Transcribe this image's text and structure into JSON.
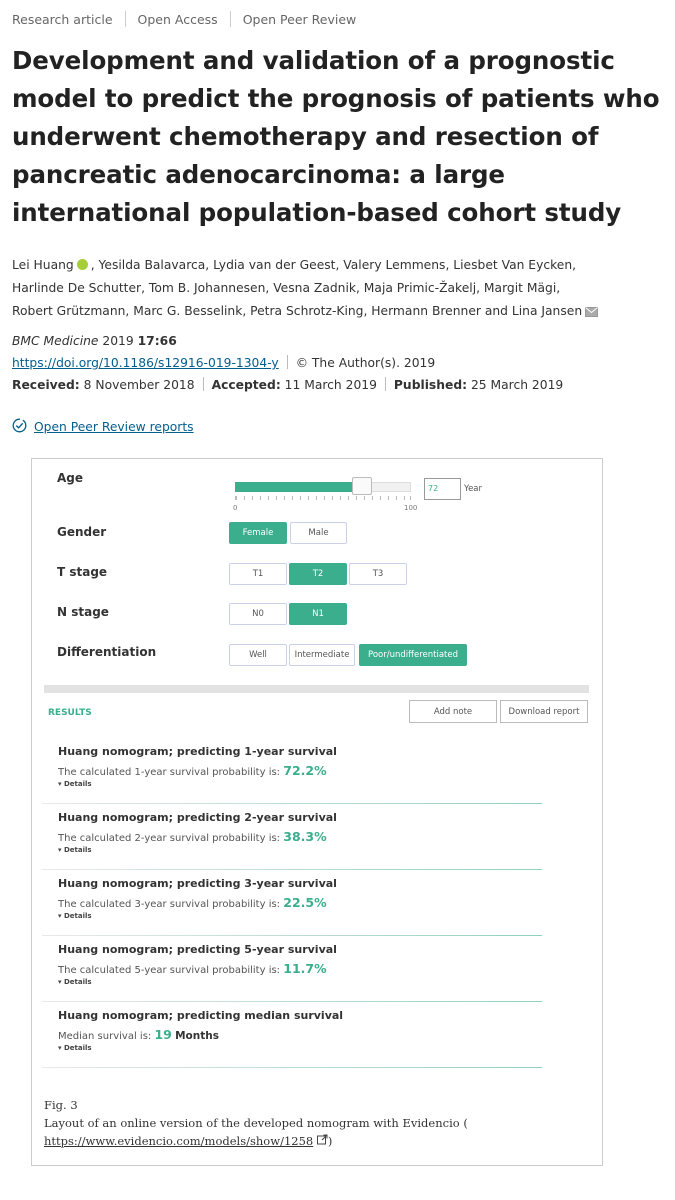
{
  "meta": {
    "type": "Research article",
    "access": "Open Access",
    "review": "Open Peer Review"
  },
  "article": {
    "title": "Development and validation of a prognostic model to predict the prognosis of patients who underwent chemotherapy and resection of pancreatic adenocarcinoma: a large international population-based cohort study"
  },
  "authors": {
    "line1_first": "Lei Huang",
    "line1_rest": ", Yesilda Balavarca, Lydia van der Geest, Valery Lemmens, Liesbet Van Eycken,",
    "line2": "Harlinde De Schutter, Tom B. Johannesen, Vesna Zadnik, Maja Primic-Žakelj, Margit Mägi,",
    "line3": "Robert Grützmann, Marc G. Besselink, Petra Schrotz-King, Hermann Brenner and Lina Jansen"
  },
  "citation": {
    "journal": "BMC Medicine",
    "year": "2019",
    "volume": "17:66",
    "doi": "https://doi.org/10.1186/s12916-019-1304-y",
    "copyright": "© The Author(s). 2019",
    "received_label": "Received:",
    "received": "8 November 2018",
    "accepted_label": "Accepted:",
    "accepted": "11 March 2019",
    "published_label": "Published:",
    "published": "25 March 2019"
  },
  "peer_review": {
    "label": "Open Peer Review reports"
  },
  "figure": {
    "form": {
      "age_label": "Age",
      "age_value": "72",
      "age_slider_fraction": 0.72,
      "age_min": "0",
      "age_max": "100",
      "age_unit": "Year",
      "gender_label": "Gender",
      "gender_options": [
        "Female",
        "Male"
      ],
      "t_label": "T stage",
      "t_options": [
        "T1",
        "T2",
        "T3"
      ],
      "n_label": "N stage",
      "n_options": [
        "N0",
        "N1"
      ],
      "diff_label": "Differentiation",
      "diff_options": [
        "Well",
        "Intermediate",
        "Poor/undifferentiated"
      ]
    },
    "results_label": "RESULTS",
    "add_note": "Add note",
    "download_report": "Download report",
    "results": [
      {
        "title": "Huang nomogram; predicting 1-year survival",
        "text": "The calculated 1-year survival probability is:",
        "value": "72.2%",
        "details": "▾ Details"
      },
      {
        "title": "Huang nomogram; predicting 2-year survival",
        "text": "The calculated 2-year survival probability is:",
        "value": "38.3%",
        "details": "▾ Details"
      },
      {
        "title": "Huang nomogram; predicting 3-year survival",
        "text": "The calculated 3-year survival probability is:",
        "value": "22.5%",
        "details": "▾ Details"
      },
      {
        "title": "Huang nomogram; predicting 5-year survival",
        "text": "The calculated 5-year survival probability is:",
        "value": "11.7%",
        "details": "▾ Details"
      },
      {
        "title": "Huang nomogram; predicting median survival",
        "text": "Median survival is:",
        "value": "19",
        "value_unit": "Months",
        "details": "▾ Details"
      }
    ],
    "caption_label": "Fig. 3",
    "caption_text": "Layout of an online version of the developed nomogram with Evidencio (",
    "caption_link": "https://www.evidencio.com/models/show/1258",
    "caption_end": ")"
  },
  "colors": {
    "accent": "#3bae8e",
    "link": "#025e8d",
    "orcid": "#a6ce39"
  }
}
